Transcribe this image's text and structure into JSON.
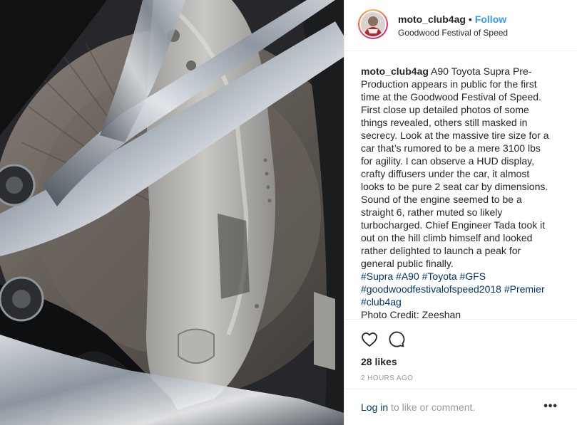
{
  "post": {
    "username": "moto_club4ag",
    "separator": "•",
    "follow_label": "Follow",
    "location": "Goodwood Festival of Speed",
    "caption_user": "moto_club4ag",
    "caption_text": "A90 Toyota Supra Pre-Production appears in public for the first time at the Goodwood Festival of Speed. First close up detailed photos of some things revealed, others still masked in secrecy. Look at the massive tire size for a car that’s rumored to be a mere 3100 lbs for agility. I can observe a HUD display, crafty diffusers under the car, it almost looks to be pure 2 seat car by dimensions. Sound of the engine seemed to be a straight 6, rather muted so likely turbocharged. Chief Engineer Tada took it out on the hill climb himself and looked rather delighted to launch a peak for general public finally.",
    "hashtags": "#Supra #A90 #Toyota #GFS #goodwoodfestivalofspeed2018 #Premier #club4ag",
    "photo_credit": "Photo Credit: Zeeshan",
    "likes": "28 likes",
    "timestamp": "2 HOURS AGO"
  },
  "actions": {
    "like_icon": "heart-icon",
    "comment_icon": "comment-icon"
  },
  "login": {
    "link_label": "Log in",
    "rest_label": " to like or comment.",
    "more_label": "•••"
  },
  "colors": {
    "link_blue": "#3897f0",
    "hashtag_blue": "#003569",
    "text": "#262626",
    "muted": "#999999",
    "border": "#efefef"
  }
}
